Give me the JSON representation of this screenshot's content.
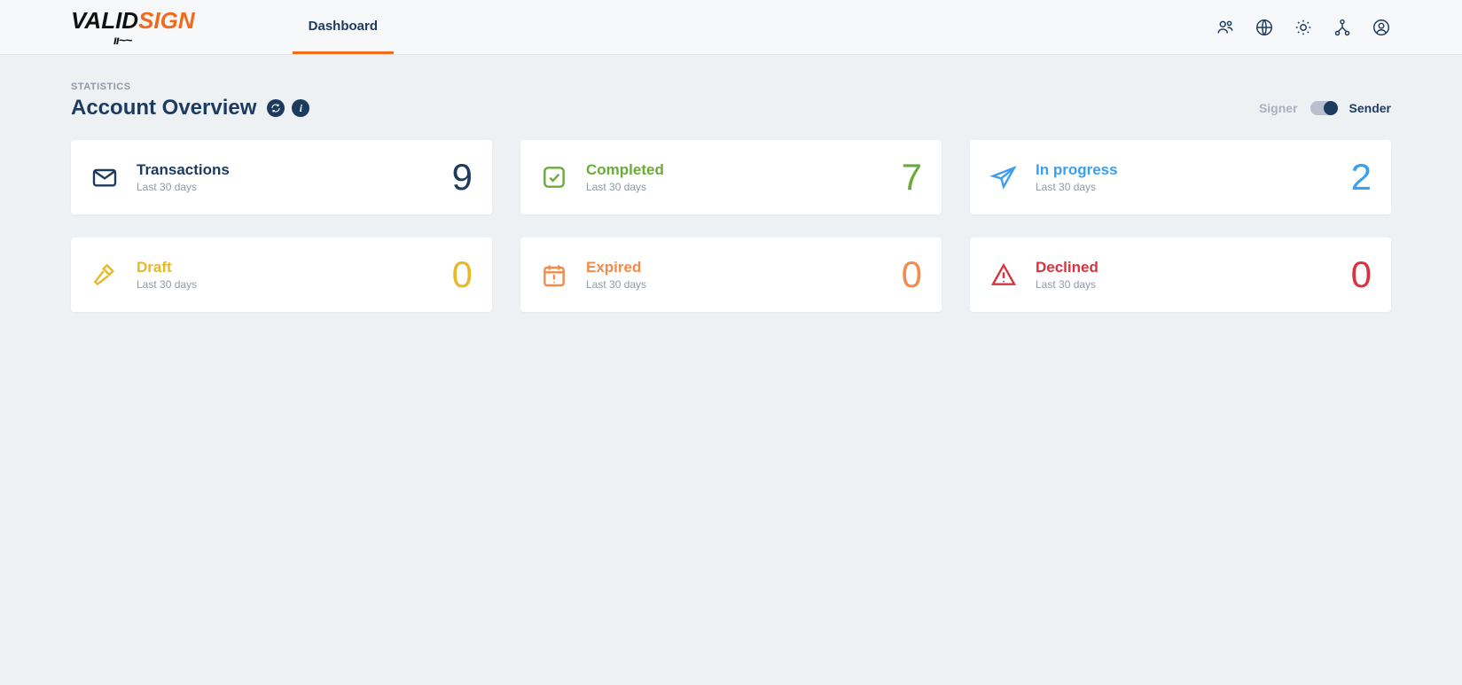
{
  "brand": {
    "part1": "VALID",
    "part2": "SIGN"
  },
  "nav": {
    "dashboard": "Dashboard"
  },
  "section_label": "STATISTICS",
  "page_title": "Account Overview",
  "toggle": {
    "signer": "Signer",
    "sender": "Sender"
  },
  "cards": {
    "transactions": {
      "title": "Transactions",
      "sub": "Last 30 days",
      "value": "9"
    },
    "completed": {
      "title": "Completed",
      "sub": "Last 30 days",
      "value": "7"
    },
    "inprogress": {
      "title": "In progress",
      "sub": "Last 30 days",
      "value": "2"
    },
    "draft": {
      "title": "Draft",
      "sub": "Last 30 days",
      "value": "0"
    },
    "expired": {
      "title": "Expired",
      "sub": "Last 30 days",
      "value": "0"
    },
    "declined": {
      "title": "Declined",
      "sub": "Last 30 days",
      "value": "0"
    }
  },
  "colors": {
    "navy": "#1d3a5f",
    "green": "#6bab3a",
    "blue": "#3a9ff0",
    "gold": "#e6b82a",
    "orange": "#f28b4b",
    "red": "#d9333f"
  }
}
